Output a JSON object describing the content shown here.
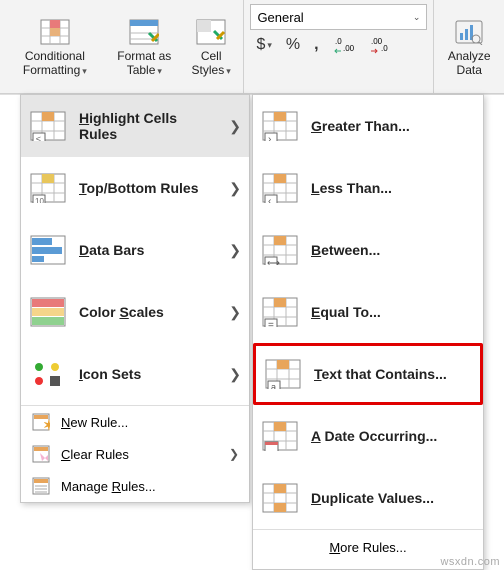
{
  "ribbon": {
    "conditional_formatting": "Conditional Formatting",
    "format_as_table": "Format as Table",
    "cell_styles": "Cell Styles",
    "number_format_selected": "General",
    "analyze_data": "Analyze Data"
  },
  "menu1": {
    "highlight_cells_rules": "Highlight Cells Rules",
    "top_bottom_rules": "Top/Bottom Rules",
    "data_bars": "Data Bars",
    "color_scales": "Color Scales",
    "icon_sets": "Icon Sets",
    "new_rule": "New Rule...",
    "clear_rules": "Clear Rules",
    "manage_rules": "Manage Rules..."
  },
  "menu2": {
    "greater_than": "Greater Than...",
    "less_than": "Less Than...",
    "between": "Between...",
    "equal_to": "Equal To...",
    "text_contains": "Text that Contains...",
    "date_occurring": "A Date Occurring...",
    "duplicate_values": "Duplicate Values...",
    "more_rules": "More Rules..."
  },
  "watermark": "wsxdn.com"
}
